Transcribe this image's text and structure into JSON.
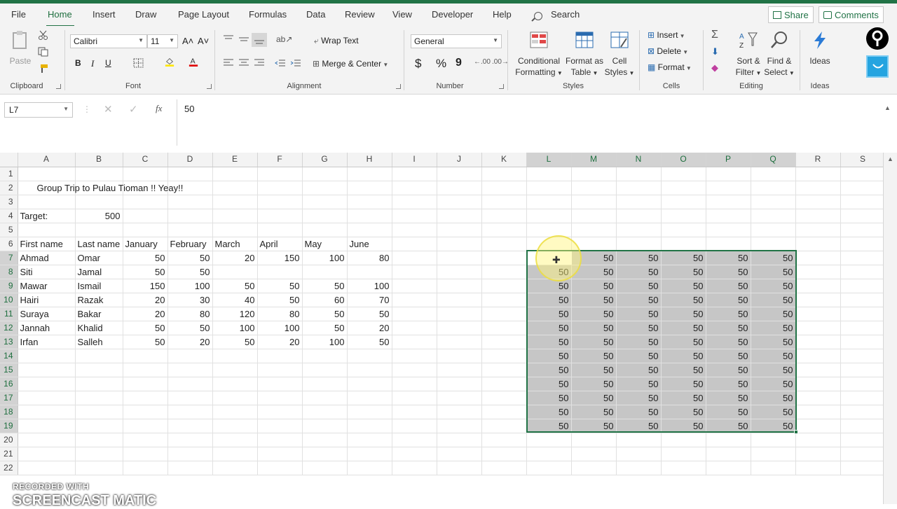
{
  "tabs": [
    "File",
    "Home",
    "Insert",
    "Draw",
    "Page Layout",
    "Formulas",
    "Data",
    "Review",
    "View",
    "Developer",
    "Help"
  ],
  "search": "Search",
  "share": "Share",
  "comments": "Comments",
  "ribbon": {
    "clipboard": {
      "paste": "Paste",
      "group": "Clipboard"
    },
    "font": {
      "name": "Calibri",
      "size": "11",
      "bold": "B",
      "italic": "I",
      "underline": "U",
      "group": "Font"
    },
    "alignment": {
      "wrap": "Wrap Text",
      "merge": "Merge & Center",
      "group": "Alignment"
    },
    "number": {
      "format": "General",
      "currency": "$",
      "percent": "%",
      "comma": "9",
      "group": "Number"
    },
    "styles": {
      "cond1": "Conditional",
      "cond2": "Formatting",
      "fmt1": "Format as",
      "fmt2": "Table",
      "cell1": "Cell",
      "cell2": "Styles",
      "group": "Styles"
    },
    "cells": {
      "insert": "Insert",
      "delete": "Delete",
      "format": "Format",
      "group": "Cells"
    },
    "editing": {
      "sort1": "Sort &",
      "sort2": "Filter",
      "find1": "Find &",
      "find2": "Select",
      "group": "Editing"
    },
    "ideas": {
      "label": "Ideas",
      "group": "Ideas"
    }
  },
  "formula_bar": {
    "namebox": "L7",
    "content": "50"
  },
  "sheet": {
    "columns": [
      "A",
      "B",
      "C",
      "D",
      "E",
      "F",
      "G",
      "H",
      "I",
      "J",
      "K",
      "L",
      "M",
      "N",
      "O",
      "P",
      "Q",
      "R",
      "S"
    ],
    "title": "Group Trip to Pulau Tioman !! Yeay!!",
    "target_label": "Target:",
    "target_value": "500",
    "headers": [
      "First name",
      "Last name",
      "January",
      "February",
      "March",
      "April",
      "May",
      "June"
    ],
    "rows": [
      [
        "Ahmad",
        "Omar",
        "50",
        "50",
        "20",
        "150",
        "100",
        "80"
      ],
      [
        "Siti",
        "Jamal",
        "50",
        "50",
        "",
        "",
        "",
        ""
      ],
      [
        "Mawar",
        "Ismail",
        "150",
        "100",
        "50",
        "50",
        "50",
        "100"
      ],
      [
        "Hairi",
        "Razak",
        "20",
        "30",
        "40",
        "50",
        "60",
        "70"
      ],
      [
        "Suraya",
        "Bakar",
        "20",
        "80",
        "120",
        "80",
        "50",
        "50"
      ],
      [
        "Jannah",
        "Khalid",
        "50",
        "50",
        "100",
        "100",
        "50",
        "20"
      ],
      [
        "Irfan",
        "Salleh",
        "50",
        "20",
        "50",
        "20",
        "100",
        "50"
      ]
    ],
    "fill_value": "50",
    "row_count": 22
  },
  "watermark": {
    "line1": "RECORDED WITH",
    "line2": "SCREENCAST  MATIC"
  }
}
